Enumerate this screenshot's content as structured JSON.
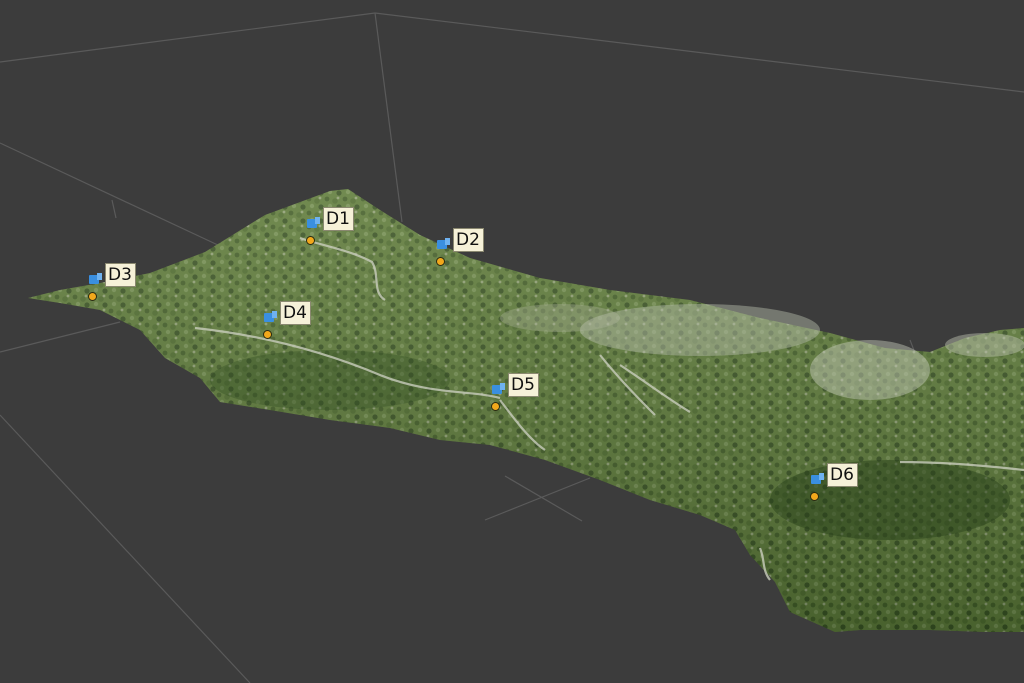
{
  "viewer": {
    "background": "#3c3c3c",
    "grid_color": "#5a5a5a"
  },
  "markers": [
    {
      "id": "D1",
      "label": "D1",
      "icon": "camera-flag-icon",
      "point_color": "#f2a81c",
      "flag_color": "#3a8fe0"
    },
    {
      "id": "D2",
      "label": "D2",
      "icon": "camera-flag-icon",
      "point_color": "#f2a81c",
      "flag_color": "#3a8fe0"
    },
    {
      "id": "D3",
      "label": "D3",
      "icon": "camera-flag-icon",
      "point_color": "#f2a81c",
      "flag_color": "#3a8fe0"
    },
    {
      "id": "D4",
      "label": "D4",
      "icon": "camera-flag-icon",
      "point_color": "#f2a81c",
      "flag_color": "#3a8fe0"
    },
    {
      "id": "D5",
      "label": "D5",
      "icon": "camera-flag-icon",
      "point_color": "#f2a81c",
      "flag_color": "#3a8fe0"
    },
    {
      "id": "D6",
      "label": "D6",
      "icon": "camera-flag-icon",
      "point_color": "#f2a81c",
      "flag_color": "#3a8fe0"
    }
  ]
}
